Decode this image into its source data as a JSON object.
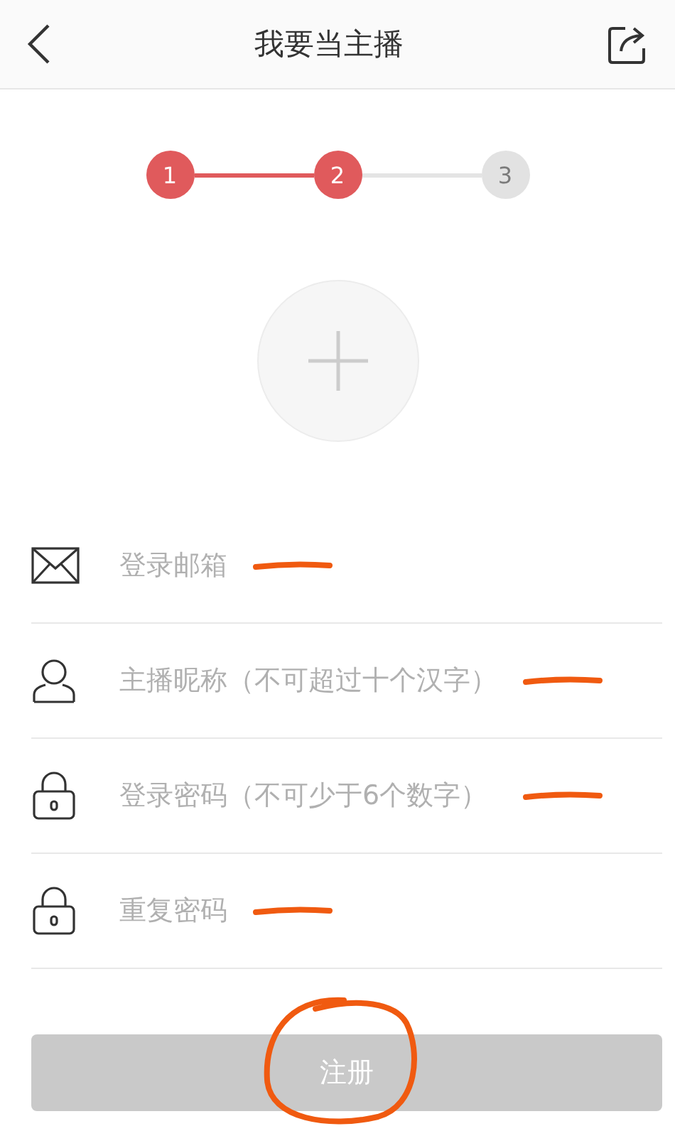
{
  "header": {
    "title": "我要当主播"
  },
  "steps": [
    {
      "label": "1",
      "done": true
    },
    {
      "label": "2",
      "done": true
    },
    {
      "label": "3",
      "done": false
    }
  ],
  "fields": [
    {
      "kind": "email",
      "placeholder": "登录邮箱",
      "annotated": true
    },
    {
      "kind": "person",
      "placeholder": "主播昵称（不可超过十个汉字）",
      "annotated": true
    },
    {
      "kind": "lock",
      "placeholder": "登录密码（不可少于6个数字）",
      "annotated": true
    },
    {
      "kind": "lock",
      "placeholder": "重复密码",
      "annotated": true
    }
  ],
  "submit": {
    "label": "注册",
    "disabled": true,
    "circled": true
  }
}
